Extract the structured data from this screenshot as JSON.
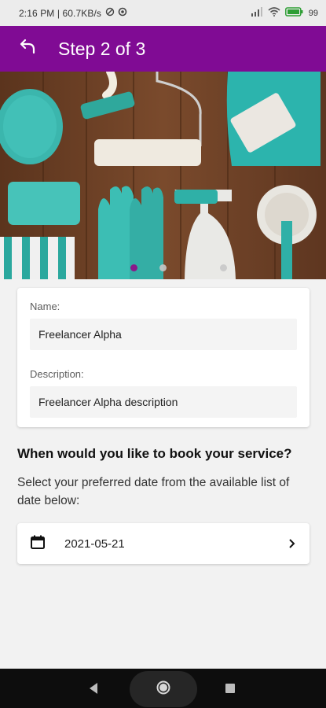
{
  "status_bar": {
    "time": "2:16 PM | 60.7KB/s",
    "battery": "99"
  },
  "app_bar": {
    "title": "Step 2 of 3",
    "back_icon": "back-arrow-icon"
  },
  "carousel": {
    "image": "cleaning-supplies-photo",
    "dot_count": 3,
    "active_index": 0
  },
  "provider": {
    "name_label": "Name:",
    "name_value": "Freelancer Alpha",
    "description_label": "Description:",
    "description_value": "Freelancer Alpha description"
  },
  "booking": {
    "heading": "When would you like to book your service?",
    "subheading": "Select your preferred date from the available list of date below:",
    "selected_date": "2021-05-21",
    "calendar_icon": "calendar-icon",
    "chevron_icon": "chevron-right-icon"
  },
  "colors": {
    "primary": "#800b94",
    "background": "#f2f2f2"
  }
}
